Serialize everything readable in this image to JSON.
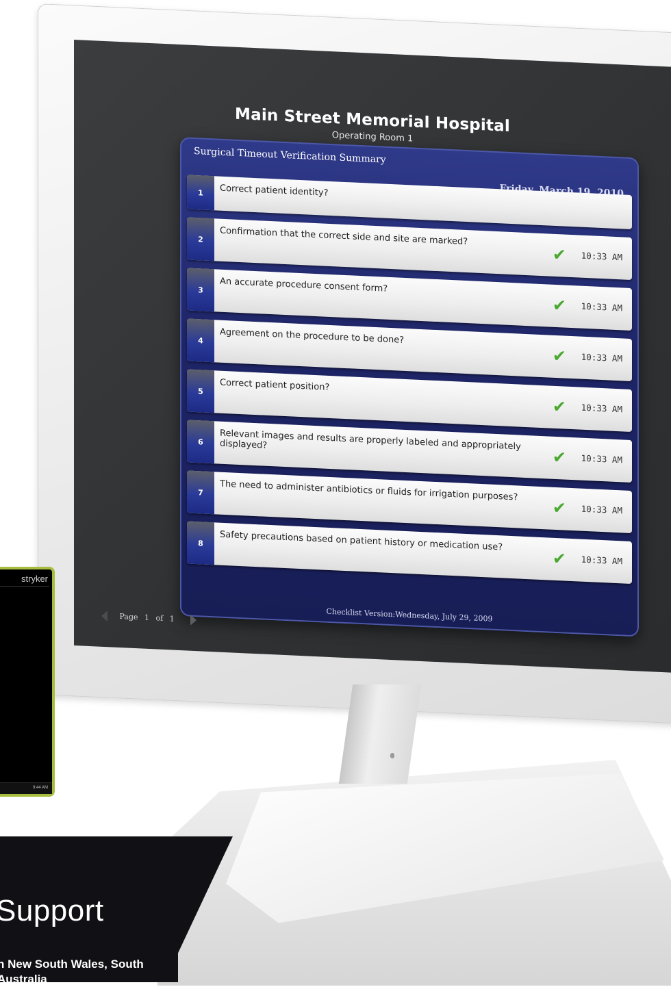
{
  "hospital": {
    "name": "Main Street Memorial Hospital",
    "room": "Operating Room 1"
  },
  "panel": {
    "title": "Surgical Timeout Verification Summary",
    "date": "Friday, March 19, 2010",
    "footer": "Checklist Version:Wednesday, July 29, 2009"
  },
  "checklist": [
    {
      "num": "1",
      "question": "Correct patient identity?",
      "time": ""
    },
    {
      "num": "2",
      "question": "Confirmation that the correct side and site are marked?",
      "time": "10:33 AM"
    },
    {
      "num": "3",
      "question": "An accurate procedure consent form?",
      "time": "10:33 AM"
    },
    {
      "num": "4",
      "question": "Agreement on the procedure to be done?",
      "time": "10:33 AM"
    },
    {
      "num": "5",
      "question": "Correct patient position?",
      "time": "10:33 AM"
    },
    {
      "num": "6",
      "question": "Relevant images and results are properly labeled and appropriately displayed?",
      "time": "10:33 AM"
    },
    {
      "num": "7",
      "question": "The need to administer antibiotics or fluids for irrigation purposes?",
      "time": "10:33 AM"
    },
    {
      "num": "8",
      "question": "Safety precautions based on patient history or medication use?",
      "time": "10:33 AM"
    }
  ],
  "pager": {
    "label": "Page",
    "current": "1",
    "of": "of",
    "total": "1"
  },
  "device": {
    "brand": "stryker",
    "time": "9:44 AM"
  },
  "footer_band": {
    "heading": "Support",
    "region_text": "n New South Wales, South Australia"
  },
  "colors": {
    "panel_blue": "#1f2668",
    "check_green": "#49a82f",
    "device_border": "#a7bd3f",
    "screen_bg": "#2f3133"
  }
}
